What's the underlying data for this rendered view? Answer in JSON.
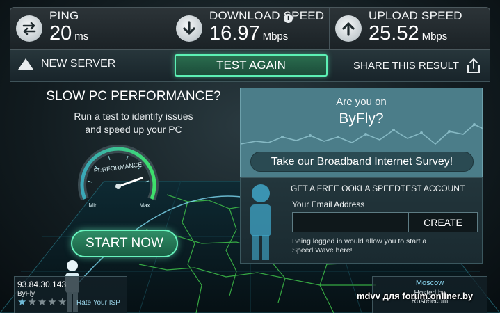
{
  "stats": {
    "ping": {
      "label": "PING",
      "value": "20",
      "unit": "ms"
    },
    "download": {
      "label": "DOWNLOAD SPEED",
      "value": "16.97",
      "unit": "Mbps"
    },
    "upload": {
      "label": "UPLOAD SPEED",
      "value": "25.52",
      "unit": "Mbps"
    },
    "info_glyph": "i"
  },
  "actions": {
    "new_server": "NEW SERVER",
    "test_again": "TEST AGAIN",
    "share": "SHARE THIS RESULT"
  },
  "promo": {
    "title": "SLOW PC PERFORMANCE?",
    "subtitle_line1": "Run a test to identify issues",
    "subtitle_line2": "and speed up your PC",
    "gauge_label": "PERFORMANCE",
    "gauge_min": "Min",
    "gauge_max": "Max",
    "start_button": "START NOW"
  },
  "survey": {
    "question": "Are you on",
    "isp": "ByFly?",
    "button": "Take our Broadband Internet Survey!"
  },
  "account": {
    "title": "GET A FREE OOKLA SPEEDTEST ACCOUNT",
    "email_label": "Your Email Address",
    "email_value": "",
    "create_button": "CREATE",
    "note": "Being logged in would allow you to start a Speed Wave here!"
  },
  "isp": {
    "ip": "93.84.30.143",
    "name": "ByFly",
    "rating": 1,
    "rating_max": 5,
    "rate_link": "Rate Your ISP"
  },
  "server": {
    "city": "Moscow",
    "hosted_by": "Hosted by",
    "name": "Rostelecom"
  },
  "watermark": "mdvv для forum.onliner.by",
  "colors": {
    "accent_green": "#5cf0b4",
    "panel_teal": "#4b7d89",
    "star_on": "#6fb9d6"
  }
}
